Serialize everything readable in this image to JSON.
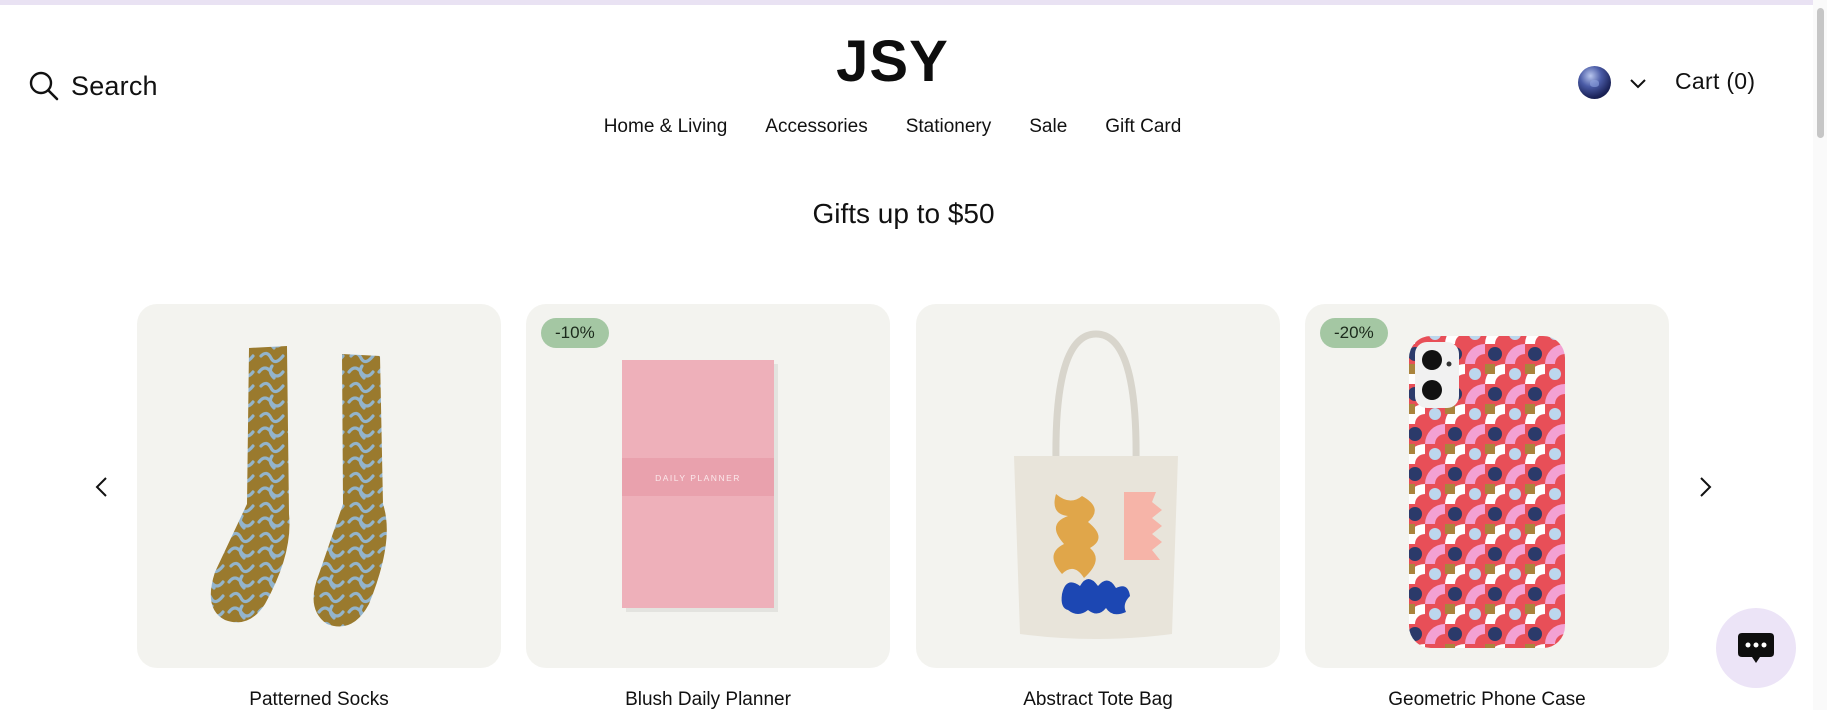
{
  "header": {
    "search_label": "Search",
    "logo": "JSY",
    "cart_label": "Cart (0)",
    "nav": [
      "Home & Living",
      "Accessories",
      "Stationery",
      "Sale",
      "Gift Card"
    ]
  },
  "section": {
    "title": "Gifts up to $50"
  },
  "products": [
    {
      "name": "Patterned Socks",
      "badge": "",
      "image": "patterned-socks"
    },
    {
      "name": "Blush Daily Planner",
      "badge": "-10%",
      "image": "pink-planner",
      "cover_text": "DAILY PLANNER"
    },
    {
      "name": "Abstract Tote Bag",
      "badge": "",
      "image": "tote-bag"
    },
    {
      "name": "Geometric Phone Case",
      "badge": "-20%",
      "image": "phone-case"
    }
  ],
  "icons": {
    "search": "search-icon",
    "globe": "globe-icon",
    "chevron": "chevron-down-icon",
    "prev": "chevron-left-icon",
    "next": "chevron-right-icon",
    "chat": "chat-icon"
  },
  "colors": {
    "badge": "#a4c7a3",
    "card_bg": "#f3f3ef",
    "top_bar": "#e9e2f3",
    "chat_bg": "#ece4f7"
  }
}
